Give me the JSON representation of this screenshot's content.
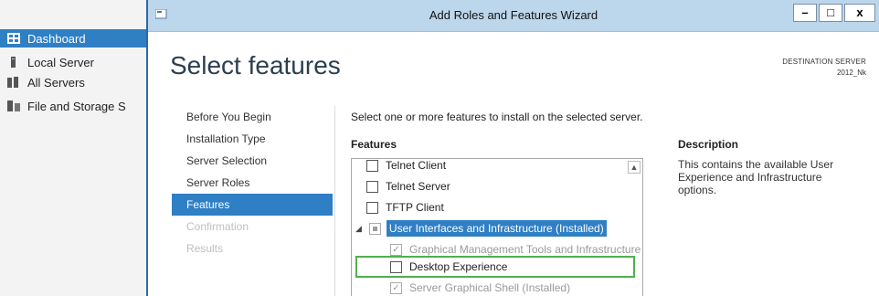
{
  "server_manager": {
    "nav": [
      {
        "label": "Dashboard",
        "icon": "dashboard-icon",
        "active": true
      },
      {
        "label": "Local Server",
        "icon": "server-icon",
        "active": false
      },
      {
        "label": "All Servers",
        "icon": "servers-icon",
        "active": false
      },
      {
        "label": "File and Storage S",
        "icon": "storage-icon",
        "active": false
      }
    ]
  },
  "window": {
    "title": "Add Roles and Features Wizard",
    "buttons": {
      "minimize": "–",
      "maximize": "□",
      "close": "x"
    }
  },
  "page": {
    "title": "Select features",
    "destination_label": "DESTINATION SERVER",
    "destination_name": "2012_Nk",
    "instructions": "Select one or more features to install on the selected server."
  },
  "steps": [
    {
      "label": "Before You Begin",
      "state": "normal"
    },
    {
      "label": "Installation Type",
      "state": "normal"
    },
    {
      "label": "Server Selection",
      "state": "normal"
    },
    {
      "label": "Server Roles",
      "state": "normal"
    },
    {
      "label": "Features",
      "state": "selected"
    },
    {
      "label": "Confirmation",
      "state": "disabled"
    },
    {
      "label": "Results",
      "state": "disabled"
    }
  ],
  "features": {
    "header": "Features",
    "items": [
      {
        "label": "Telnet Client",
        "checked": false
      },
      {
        "label": "Telnet Server",
        "checked": false
      },
      {
        "label": "TFTP Client",
        "checked": false
      },
      {
        "label": "User Interfaces and Infrastructure (Installed)",
        "checked": "partial",
        "expanded": true
      },
      {
        "label": "Graphical Management Tools and Infrastructure",
        "checked": true
      },
      {
        "label": "Desktop Experience",
        "checked": false
      },
      {
        "label": "Server Graphical Shell (Installed)",
        "checked": true
      }
    ],
    "highlight_color": "#4fb04f"
  },
  "description": {
    "header": "Description",
    "text": "This contains the available User Experience and Infrastructure options."
  },
  "colors": {
    "accent": "#2f7fc4",
    "titlebar": "#bcd6ec"
  }
}
